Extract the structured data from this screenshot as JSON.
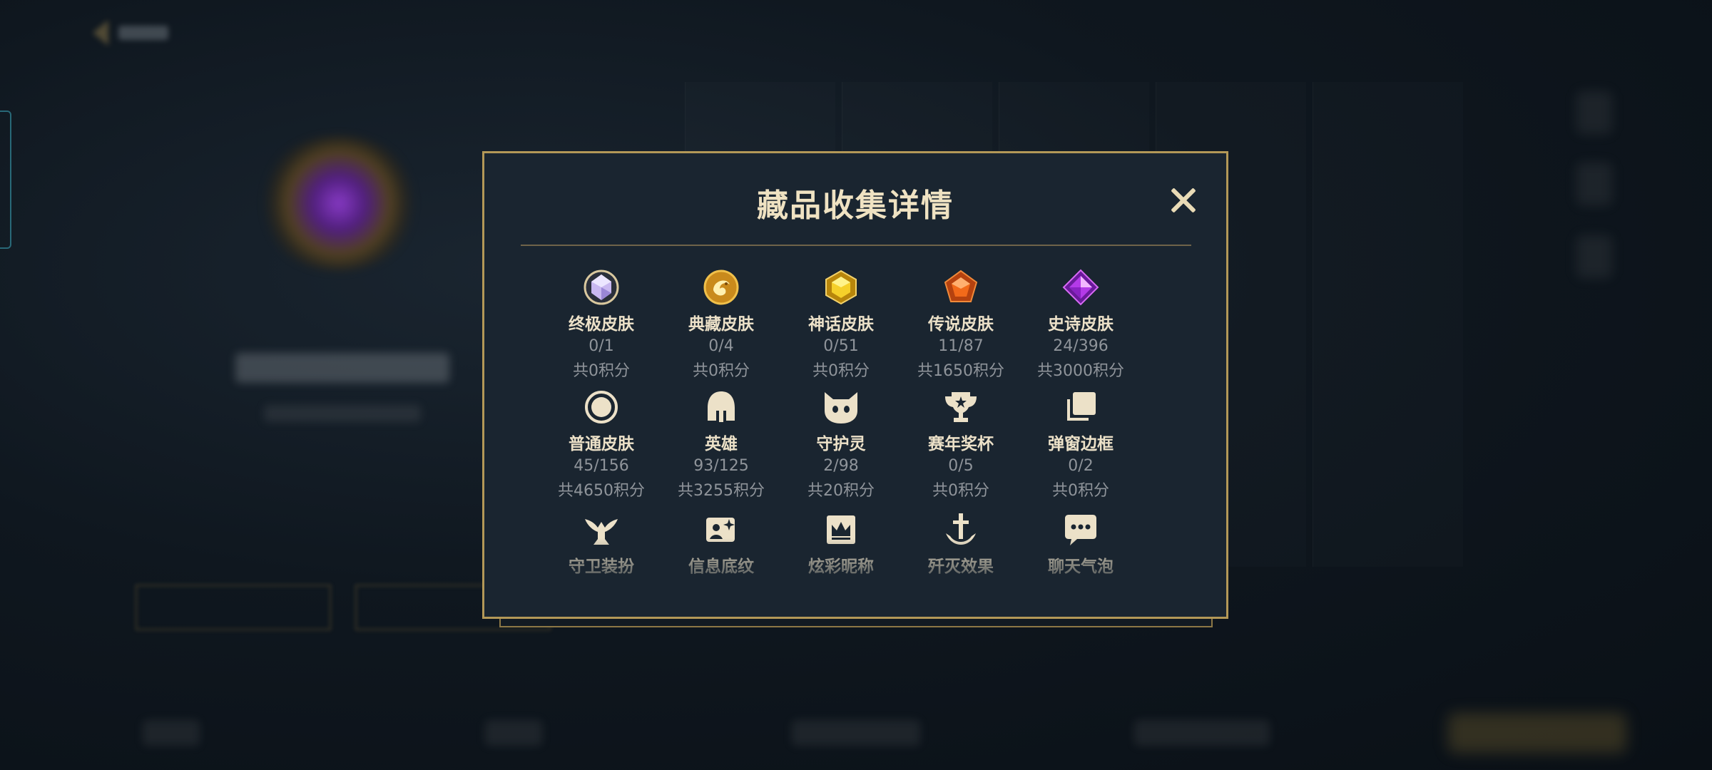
{
  "modal": {
    "title": "藏品收集详情"
  },
  "categories": [
    {
      "label": "终极皮肤",
      "count": "0/1",
      "points": "共0积分",
      "icon": "ultimate-gem-icon"
    },
    {
      "label": "典藏皮肤",
      "count": "0/4",
      "points": "共0积分",
      "icon": "dragon-coin-icon"
    },
    {
      "label": "神话皮肤",
      "count": "0/51",
      "points": "共0积分",
      "icon": "mythic-gem-icon"
    },
    {
      "label": "传说皮肤",
      "count": "11/87",
      "points": "共1650积分",
      "icon": "legend-gem-icon"
    },
    {
      "label": "史诗皮肤",
      "count": "24/396",
      "points": "共3000积分",
      "icon": "epic-gem-icon"
    },
    {
      "label": "普通皮肤",
      "count": "45/156",
      "points": "共4650积分",
      "icon": "ring-icon"
    },
    {
      "label": "英雄",
      "count": "93/125",
      "points": "共3255积分",
      "icon": "helmet-icon"
    },
    {
      "label": "守护灵",
      "count": "2/98",
      "points": "共20积分",
      "icon": "pet-face-icon"
    },
    {
      "label": "赛年奖杯",
      "count": "0/5",
      "points": "共0积分",
      "icon": "trophy-icon"
    },
    {
      "label": "弹窗边框",
      "count": "0/2",
      "points": "共0积分",
      "icon": "frames-icon"
    },
    {
      "label": "守卫装扮",
      "icon": "ward-icon"
    },
    {
      "label": "信息底纹",
      "icon": "card-sparkle-icon"
    },
    {
      "label": "炫彩昵称",
      "icon": "crown-card-icon"
    },
    {
      "label": "歼灭效果",
      "icon": "anchor-sword-icon"
    },
    {
      "label": "聊天气泡",
      "icon": "chat-bubble-icon"
    }
  ],
  "colors": {
    "accent_gold": "#b39857",
    "title_text": "#efe2c2",
    "muted_text": "#8f949a",
    "panel_bg": "#1a2530"
  }
}
